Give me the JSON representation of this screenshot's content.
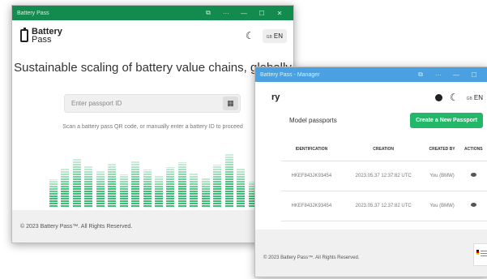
{
  "window1": {
    "title": "Battery Pass",
    "controls": [
      "⧉",
      "···",
      "—",
      "☐",
      "✕"
    ],
    "brand_line1": "Battery",
    "brand_line2": "Pass",
    "theme_icon": "☾",
    "lang_flag": "GB",
    "lang": "EN",
    "headline": "Sustainable scaling of battery value chains, globally",
    "search_placeholder": "Enter passport ID",
    "qr_icon": "▦",
    "hint": "Scan a battery pass QR code, or manually enter a battery ID to proceed",
    "bar_levels": [
      0.45,
      0.62,
      0.78,
      0.66,
      0.58,
      0.7,
      0.52,
      0.74,
      0.6,
      0.5,
      0.64,
      0.72,
      0.55,
      0.47,
      0.68,
      0.86,
      0.63,
      0.41
    ],
    "footer_copy": "© 2023 Battery Pass™. All Rights Reserved."
  },
  "window2": {
    "title": "Battery Pass - Manager",
    "controls": [
      "⧉",
      "···",
      "—",
      "☐"
    ],
    "brand_cut": "ry",
    "theme_icon": "☾",
    "lang_flag": "GB",
    "lang": "EN",
    "section_label": "Model passports",
    "create_button": "Create a New Passport",
    "columns": [
      "IDENTIFICATION",
      "CREATION",
      "CREATED BY",
      "ACTIONS"
    ],
    "rows": [
      {
        "id": "HKEF843JK93454",
        "created": "2023.05.37 12:37:82 UTC",
        "by": "You (BMW)"
      },
      {
        "id": "HKEF843JK93454",
        "created": "2023.05.37 12:37:82 UTC",
        "by": "You (BMW)"
      }
    ],
    "footer_copy": "© 2023 Battery Pass™. All Rights Reserved."
  },
  "colors": {
    "green_titlebar": "#138a4e",
    "blue_titlebar": "#4aa0e0",
    "accent_green": "#22b769"
  }
}
